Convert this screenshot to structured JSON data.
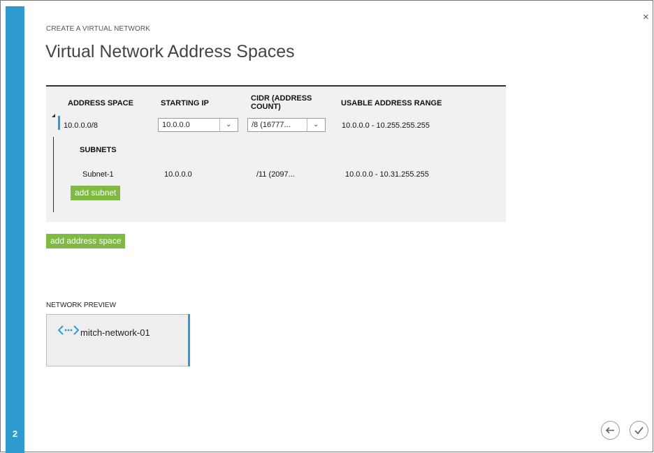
{
  "wizard": {
    "kicker": "CREATE A VIRTUAL NETWORK",
    "title": "Virtual Network Address Spaces",
    "step": "2",
    "close_symbol": "×"
  },
  "address_table": {
    "headers": {
      "address_space": "ADDRESS SPACE",
      "starting_ip": "STARTING IP",
      "cidr_line1": "CIDR (ADDRESS",
      "cidr_line2": "COUNT)",
      "usable_range": "USABLE ADDRESS RANGE"
    },
    "row": {
      "address_space": "10.0.0.0/8",
      "starting_ip": "10.0.0.0",
      "cidr": "/8 (16777...",
      "usable_range": "10.0.0.0 - 10.255.255.255"
    },
    "subnets_label": "SUBNETS",
    "subnet": {
      "name": "Subnet-1",
      "starting_ip": "10.0.0.0",
      "cidr": "/11 (2097...",
      "usable_range": "10.0.0.0 - 10.31.255.255"
    },
    "add_subnet_label": "add subnet"
  },
  "add_address_space_label": "add address space",
  "preview": {
    "label": "NETWORK PREVIEW",
    "network_name": "mitch-network-01",
    "icon": "virtual-network-icon"
  },
  "nav": {
    "back_icon": "back-arrow-icon",
    "complete_icon": "checkmark-icon"
  },
  "colors": {
    "accent_blue": "#2e9bd0",
    "button_green": "#7fba42",
    "panel_bg": "#f1f1f1"
  }
}
